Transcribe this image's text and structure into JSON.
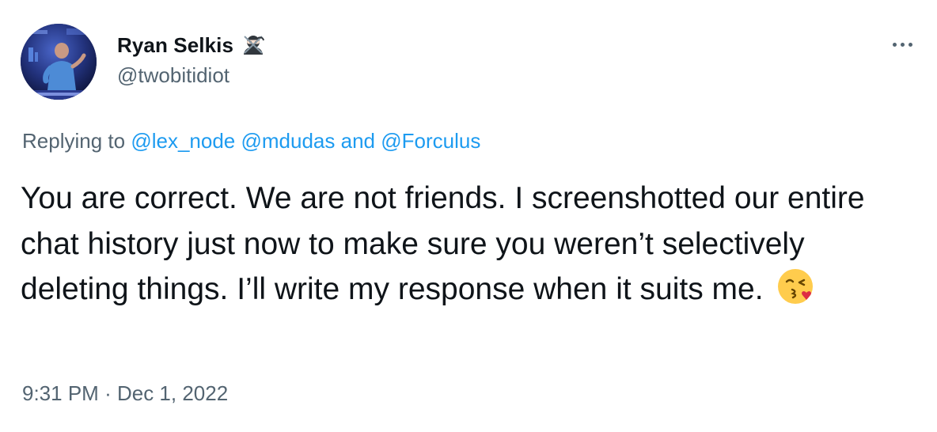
{
  "author": {
    "display_name": "Ryan Selkis",
    "handle": "@twobitidiot",
    "name_emoji": "ninja-icon",
    "avatar": "speaker-on-stage-photo"
  },
  "reply": {
    "prefix": "Replying to",
    "mention_1": "@lex_node",
    "mention_2": "@mdudas",
    "conjunction": "and",
    "mention_3": "@Forculus"
  },
  "tweet": {
    "text": "You are correct. We are not friends. I screenshotted our entire chat history just now to make sure you weren’t selectively deleting things. I’ll write my response when it suits me.",
    "trailing_emoji": "face-blowing-a-kiss-icon"
  },
  "meta": {
    "time": "9:31 PM",
    "separator": "·",
    "date": "Dec 1, 2022"
  },
  "colors": {
    "link": "#1d9bf0",
    "secondary_text": "#536471",
    "primary_text": "#0f1419"
  },
  "icons": {
    "more": "more-horizontal-icon"
  }
}
